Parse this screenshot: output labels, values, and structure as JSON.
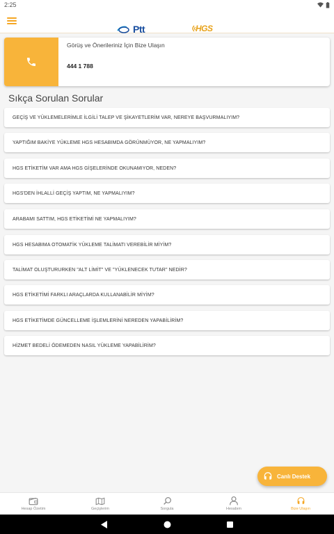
{
  "status_bar": {
    "time": "2:25"
  },
  "header": {
    "ptt_logo": "Ptt",
    "hgs_logo": "HGS"
  },
  "contact": {
    "title": "Görüş ve Önerileriniz İçin Bize Ulaşın",
    "phone": "444 1 788"
  },
  "faq": {
    "title": "Sıkça Sorulan Sorular",
    "items": [
      "GEÇİŞ VE YÜKLEMELERİMLE İLGİLİ TALEP VE ŞİKAYETLERİM VAR, NEREYE BAŞVURMALIYIM?",
      "YAPTIĞIM BAKİYE YÜKLEME HGS HESABIMDA GÖRÜNMÜYOR, NE YAPMALIYIM?",
      "HGS ETİKETİM VAR AMA HGS GİŞELERİNDE OKUNAMIYOR, NEDEN?",
      "HGS'DEN İHLALLİ GEÇİŞ YAPTIM, NE YAPMALIYIM?",
      "ARABAMI SATTIM, HGS ETİKETİMİ NE YAPMALIYIM?",
      "HGS HESABIMA OTOMATİK YÜKLEME TALİMATI VEREBİLİR MİYİM?",
      "TALİMAT OLUŞTURURKEN \"ALT LİMİT\" VE \"YÜKLENECEK TUTAR\" NEDİR?",
      "HGS ETİKETİMİ FARKLI ARAÇLARDA KULLANABİLİR MİYİM?",
      "HGS ETİKETİMDE GÜNCELLEME İŞLEMLERİNİ NEREDEN YAPABİLİRİM?",
      "HİZMET BEDELİ ÖDEMEDEN NASIL YÜKLEME YAPABİLİRİM?"
    ]
  },
  "live_support": {
    "label": "Canlı Destek",
    "icon": "headset-icon"
  },
  "bottom_nav": {
    "items": [
      {
        "label": "Hesap Özetim",
        "icon": "wallet-icon"
      },
      {
        "label": "Geçişlerim",
        "icon": "road-map-icon"
      },
      {
        "label": "Sorgula",
        "icon": "search-icon"
      },
      {
        "label": "Hesabım",
        "icon": "user-icon"
      },
      {
        "label": "Bize Ulaşın",
        "icon": "headset-icon"
      }
    ],
    "active_index": 4
  },
  "colors": {
    "accent": "#f8b43a",
    "brand_blue": "#1a4fa0"
  }
}
